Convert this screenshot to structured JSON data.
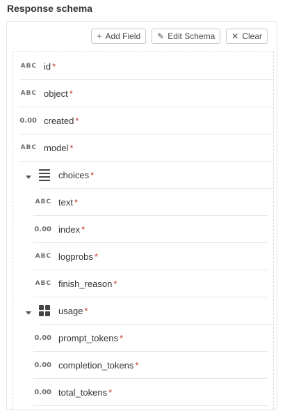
{
  "section_title": "Response schema",
  "toolbar": {
    "add_field": "Add Field",
    "edit_schema": "Edit Schema",
    "clear": "Clear"
  },
  "fields": {
    "id": {
      "type": "ABC",
      "name": "id",
      "req": "*"
    },
    "object": {
      "type": "ABC",
      "name": "object",
      "req": "*"
    },
    "created": {
      "type": "0.00",
      "name": "created",
      "req": "*"
    },
    "model": {
      "type": "ABC",
      "name": "model",
      "req": "*"
    },
    "choices": {
      "name": "choices",
      "req": "*"
    },
    "text": {
      "type": "ABC",
      "name": "text",
      "req": "*"
    },
    "index": {
      "type": "0.00",
      "name": "index",
      "req": "*"
    },
    "logprobs": {
      "type": "ABC",
      "name": "logprobs",
      "req": "*"
    },
    "finish_reason": {
      "type": "ABC",
      "name": "finish_reason",
      "req": "*"
    },
    "usage": {
      "name": "usage",
      "req": "*"
    },
    "prompt_tokens": {
      "type": "0.00",
      "name": "prompt_tokens",
      "req": "*"
    },
    "completion_tokens": {
      "type": "0.00",
      "name": "completion_tokens",
      "req": "*"
    },
    "total_tokens": {
      "type": "0.00",
      "name": "total_tokens",
      "req": "*"
    }
  }
}
